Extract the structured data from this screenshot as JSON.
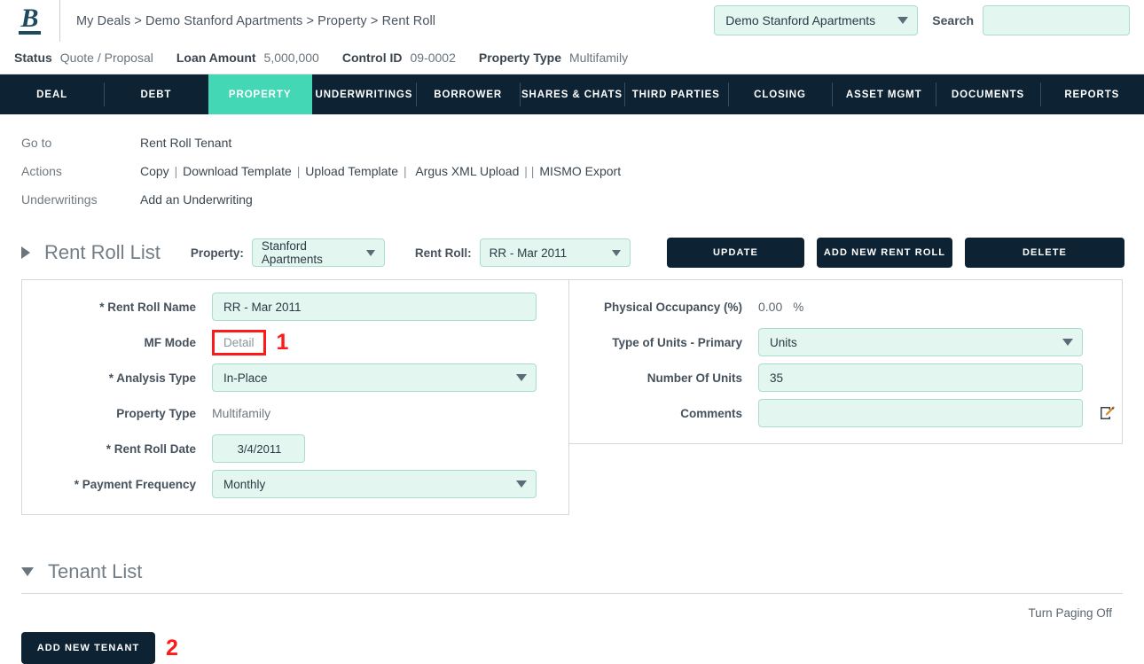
{
  "header": {
    "logo_text": "B",
    "breadcrumb": "My Deals > Demo Stanford Apartments > Property > Rent Roll",
    "deal_select_value": "Demo Stanford Apartments",
    "search_label": "Search",
    "search_value": "",
    "search_placeholder": ""
  },
  "status_strip": [
    {
      "label": "Status",
      "value": "Quote / Proposal"
    },
    {
      "label": "Loan Amount",
      "value": "5,000,000"
    },
    {
      "label": "Control ID",
      "value": "09-0002"
    },
    {
      "label": "Property Type",
      "value": "Multifamily"
    }
  ],
  "nav": {
    "active": "PROPERTY",
    "items": [
      {
        "label": "DEAL"
      },
      {
        "label": "DEBT"
      },
      {
        "label": "PROPERTY"
      },
      {
        "label": "UNDERWRITINGS"
      },
      {
        "label": "BORROWER"
      },
      {
        "label": "SHARES & CHATS"
      },
      {
        "label": "THIRD PARTIES"
      },
      {
        "label": "CLOSING"
      },
      {
        "label": "ASSET MGMT"
      },
      {
        "label": "DOCUMENTS"
      },
      {
        "label": "REPORTS"
      }
    ]
  },
  "quick_links": {
    "goto_label": "Go to",
    "goto_value": "Rent Roll Tenant",
    "actions_label": "Actions",
    "actions": [
      "Copy",
      "Download Template",
      "Upload Template",
      "",
      "Argus XML Upload",
      "",
      "MISMO Export"
    ],
    "underwritings_label": "Underwritings",
    "underwritings_value": "Add an Underwriting"
  },
  "rent_roll_list": {
    "title": "Rent Roll List",
    "property_label": "Property:",
    "property_value": "Stanford Apartments",
    "rentroll_label": "Rent Roll:",
    "rentroll_value": "RR - Mar 2011",
    "buttons": {
      "update": "UPDATE",
      "add_new_rent_roll": "ADD NEW RENT ROLL",
      "delete": "DELETE"
    }
  },
  "form_left": {
    "rent_roll_name_label": "* Rent Roll Name",
    "rent_roll_name_value": "RR - Mar 2011",
    "mf_mode_label": "MF Mode",
    "mf_mode_value": "Detail",
    "analysis_type_label": "* Analysis Type",
    "analysis_type_value": "In-Place",
    "property_type_label": "Property Type",
    "property_type_value": "Multifamily",
    "rent_roll_date_label": "* Rent Roll Date",
    "rent_roll_date_value": "3/4/2011",
    "payment_frequency_label": "* Payment Frequency",
    "payment_frequency_value": "Monthly"
  },
  "form_right": {
    "physical_occupancy_label": "Physical Occupancy (%)",
    "physical_occupancy_value": "0.00",
    "physical_occupancy_unit": "%",
    "type_of_units_label": "Type of Units - Primary",
    "type_of_units_value": "Units",
    "number_of_units_label": "Number Of Units",
    "number_of_units_value": "35",
    "comments_label": "Comments",
    "comments_value": "",
    "comments_placeholder": ""
  },
  "tenant_list": {
    "title": "Tenant List",
    "paging_toggle": "Turn Paging Off",
    "add_new_tenant": "ADD NEW TENANT"
  },
  "annotations": {
    "one": "1",
    "two": "2",
    "color": "#ff1a1a"
  }
}
